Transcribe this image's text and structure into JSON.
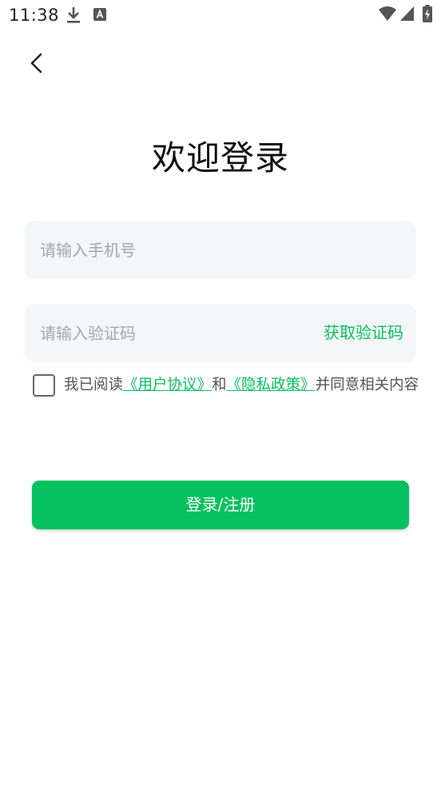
{
  "status_bar": {
    "time": "11:38",
    "icons": [
      "download-icon",
      "app-notification-icon",
      "wifi-icon",
      "signal-icon",
      "battery-charging-icon"
    ]
  },
  "header": {
    "back_icon": "chevron-left-icon",
    "title": "欢迎登录"
  },
  "form": {
    "phone": {
      "placeholder": "请输入手机号",
      "value": ""
    },
    "code": {
      "placeholder": "请输入验证码",
      "value": ""
    },
    "get_code_label": "获取验证码",
    "agreement": {
      "checked": false,
      "prefix": "我已阅读",
      "user_agreement": "《用户协议》",
      "connector": "和",
      "privacy_policy": "《隐私政策》",
      "suffix": "并同意相关内容"
    },
    "submit_label": "登录/注册"
  },
  "colors": {
    "accent": "#07c160",
    "input_bg": "#f5f6f8",
    "placeholder": "#a3a6ab",
    "text": "#0f0f0f"
  }
}
